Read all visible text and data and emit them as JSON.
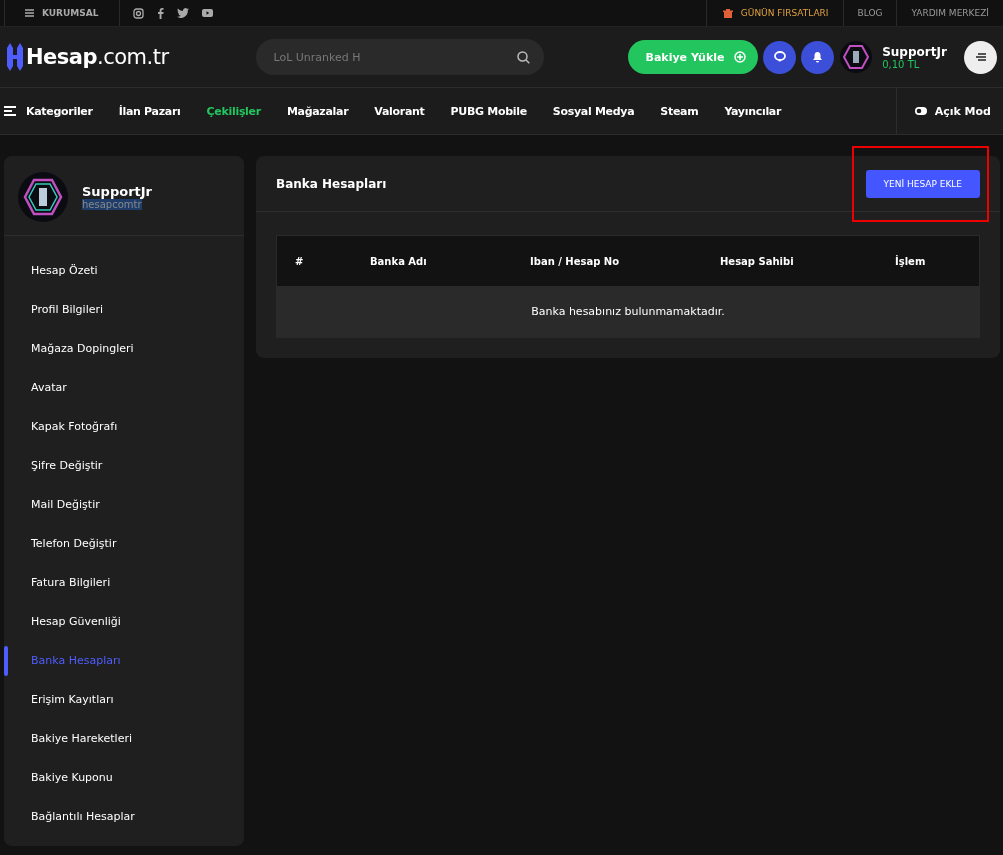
{
  "top_bar": {
    "menu_label": "KURUMSAL",
    "links": [
      {
        "label": "GÜNÜN FIRSATLARI",
        "kind": "deal"
      },
      {
        "label": "BLOG",
        "kind": "plain"
      },
      {
        "label": "YARDIM MERKEZİ",
        "kind": "plain"
      }
    ]
  },
  "header": {
    "logo_main": "Hesap",
    "logo_suffix": ".com.tr",
    "search": {
      "placeholder": "LoL Unranked H"
    },
    "balance_button": "Bakiye Yükle",
    "user": {
      "name": "SupportJr",
      "balance": "0,10 TL"
    }
  },
  "nav": {
    "items": [
      {
        "label": "Kategoriler",
        "selected": false
      },
      {
        "label": "İlan Pazarı",
        "selected": false
      },
      {
        "label": "Çekilişler",
        "selected": true
      },
      {
        "label": "Mağazalar",
        "selected": false
      },
      {
        "label": "Valorant",
        "selected": false
      },
      {
        "label": "PUBG Mobile",
        "selected": false
      },
      {
        "label": "Sosyal Medya",
        "selected": false
      },
      {
        "label": "Steam",
        "selected": false
      },
      {
        "label": "Yayıncılar",
        "selected": false
      }
    ],
    "mode_toggle": "Açık Mod"
  },
  "sidebar": {
    "profile": {
      "name": "SupportJr",
      "handle": "hesapcomtr",
      "handle_highlighted": true
    },
    "items": [
      {
        "label": "Hesap Özeti",
        "selected": false
      },
      {
        "label": "Profil Bilgileri",
        "selected": false
      },
      {
        "label": "Mağaza Dopingleri",
        "selected": false
      },
      {
        "label": "Avatar",
        "selected": false
      },
      {
        "label": "Kapak Fotoğrafı",
        "selected": false
      },
      {
        "label": "Şifre Değiştir",
        "selected": false
      },
      {
        "label": "Mail Değiştir",
        "selected": false
      },
      {
        "label": "Telefon Değiştir",
        "selected": false
      },
      {
        "label": "Fatura Bilgileri",
        "selected": false
      },
      {
        "label": "Hesap Güvenliği",
        "selected": false
      },
      {
        "label": "Banka Hesapları",
        "selected": true
      },
      {
        "label": "Erişim Kayıtları",
        "selected": false
      },
      {
        "label": "Bakiye Hareketleri",
        "selected": false
      },
      {
        "label": "Bakiye Kuponu",
        "selected": false
      },
      {
        "label": "Bağlantılı Hesaplar",
        "selected": false
      }
    ]
  },
  "panel": {
    "title": "Banka Hesapları",
    "add_button": "YENİ HESAP EKLE",
    "add_button_highlighted": true,
    "table": {
      "columns": [
        "#",
        "Banka Adı",
        "Iban / Hesap No",
        "Hesap Sahibi",
        "İşlem"
      ],
      "empty_message": "Banka hesabınız bulunmamaktadır."
    }
  }
}
